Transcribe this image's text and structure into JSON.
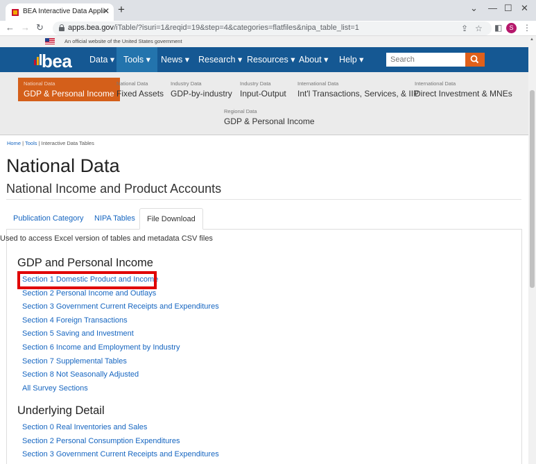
{
  "browser": {
    "tab_title": "BEA Interactive Data Application",
    "url_host": "apps.bea.gov",
    "url_path": "/iTable/?isuri=1&reqid=19&step=4&categories=flatfiles&nipa_table_list=1",
    "profile_initial": "S"
  },
  "gov_banner": "An official website of the United States government",
  "main_nav": {
    "logo": "bea",
    "items": [
      "Data ▾",
      "Tools ▾",
      "News ▾",
      "Research ▾",
      "Resources ▾",
      "About ▾",
      "Help ▾"
    ],
    "active_index": 1,
    "search_placeholder": "Search"
  },
  "sub_nav": [
    {
      "category": "National Data",
      "label": "GDP & Personal Income",
      "active": true
    },
    {
      "category": "National Data",
      "label": "Fixed Assets"
    },
    {
      "category": "Industry Data",
      "label": "GDP-by-industry"
    },
    {
      "category": "Industry Data",
      "label": "Input-Output"
    },
    {
      "category": "International Data",
      "label": "Int'l Transactions, Services, & IIP"
    },
    {
      "category": "International Data",
      "label": "Direct Investment & MNEs"
    },
    {
      "category": "Regional Data",
      "label": "GDP & Personal Income"
    }
  ],
  "breadcrumb": [
    "Home",
    "Tools",
    "Interactive Data Tables"
  ],
  "page": {
    "title": "National Data",
    "subtitle": "National Income and Product Accounts"
  },
  "tabs": [
    "Publication Category",
    "NIPA Tables",
    "File Download"
  ],
  "active_tab": 2,
  "panel_description": "Used to access Excel version of tables and metadata CSV files",
  "sections": [
    {
      "heading": "GDP and Personal Income",
      "links": [
        "Section 1 Domestic Product and Income",
        "Section 2 Personal Income and Outlays",
        "Section 3 Government Current Receipts and Expenditures",
        "Section 4 Foreign Transactions",
        "Section 5 Saving and Investment",
        "Section 6 Income and Employment by Industry",
        "Section 7 Supplemental Tables",
        "Section 8 Not Seasonally Adjusted",
        "All Survey Sections"
      ]
    },
    {
      "heading": "Underlying Detail",
      "links": [
        "Section 0 Real Inventories and Sales",
        "Section 2 Personal Consumption Expenditures",
        "Section 3 Government Current Receipts and Expenditures"
      ]
    }
  ],
  "colors": {
    "nav_blue": "#155893",
    "accent_orange": "#d45f1a",
    "link_blue": "#1565c0",
    "highlight_red": "#e00000"
  }
}
